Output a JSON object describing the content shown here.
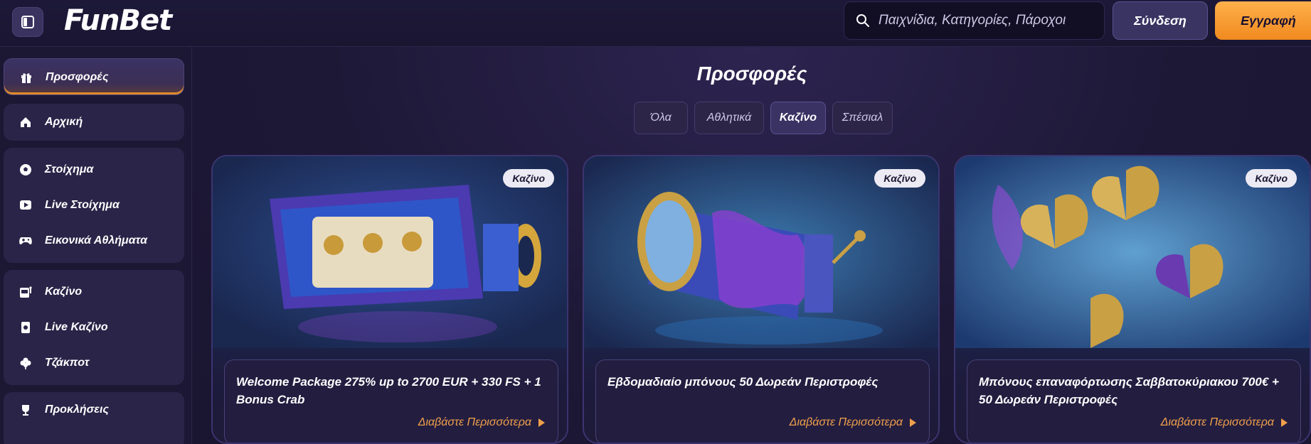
{
  "header": {
    "brand": "FunBet",
    "search_placeholder": "Παιχνίδια, Κατηγορίες, Πάροχοι",
    "login_label": "Σύνδεση",
    "register_label": "Εγγραφή"
  },
  "sidebar": {
    "items": [
      {
        "label": "Προσφορές",
        "icon": "gift-icon"
      },
      {
        "label": "Αρχική",
        "icon": "home-icon"
      },
      {
        "label": "Στοίχημα",
        "icon": "soccer-ball-icon"
      },
      {
        "label": "Live Στοίχημα",
        "icon": "live-play-icon"
      },
      {
        "label": "Εικονικά Αθλήματα",
        "icon": "gamepad-icon"
      },
      {
        "label": "Καζίνο",
        "icon": "slot-machine-icon"
      },
      {
        "label": "Live Καζίνο",
        "icon": "cards-icon"
      },
      {
        "label": "Τζάκποτ",
        "icon": "clover-icon"
      },
      {
        "label": "Προκλήσεις",
        "icon": "trophy-icon"
      }
    ]
  },
  "main": {
    "title": "Προσφορές",
    "tabs": [
      {
        "label": "Όλα"
      },
      {
        "label": "Αθλητικά"
      },
      {
        "label": "Καζίνο"
      },
      {
        "label": "Σπέσιαλ"
      }
    ],
    "active_tab": "Καζίνο",
    "cards": [
      {
        "badge": "Καζίνο",
        "title": "Welcome Package 275% up to 2700 EUR + 330 FS + 1 Bonus Crab",
        "link": "Διαβάστε Περισσότερα"
      },
      {
        "badge": "Καζίνο",
        "title": "Εβδομαδιαίο μπόνους 50 Δωρεάν Περιστροφές",
        "link": "Διαβάστε Περισσότερα"
      },
      {
        "badge": "Καζίνο",
        "title": "Μπόνους επαναφόρτωσης Σαββατοκύριακου 700€ + 50 Δωρεάν Περιστροφές",
        "link": "Διαβάστε Περισσότερα"
      }
    ]
  },
  "colors": {
    "background": "#1c1733",
    "accent_orange": "#f08a1f",
    "link_orange": "#f0a04a",
    "panel": "#2a2448"
  }
}
